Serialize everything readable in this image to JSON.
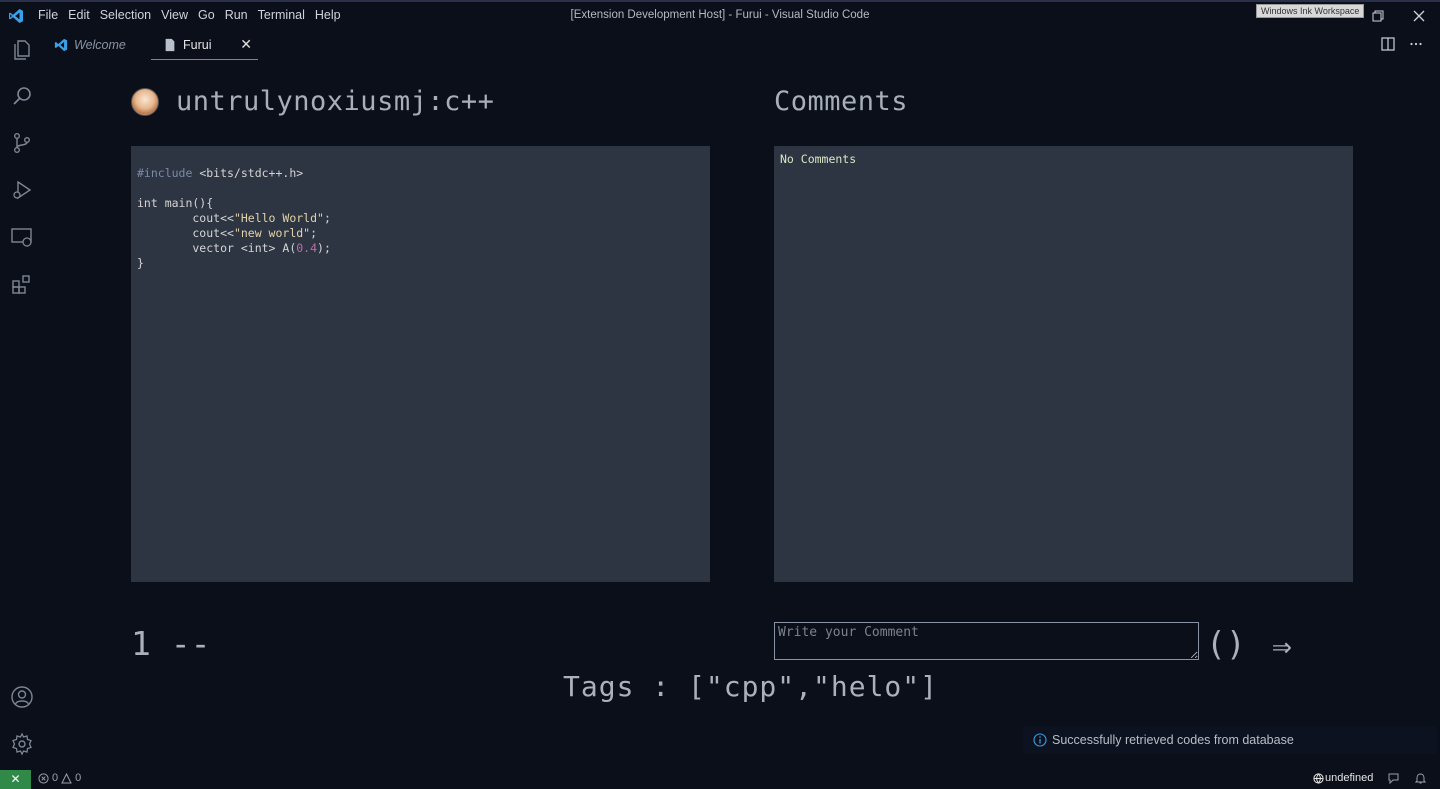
{
  "window": {
    "title": "[Extension Development Host] - Furui - Visual Studio Code",
    "ink_workspace": "Windows Ink Workspace"
  },
  "menu": [
    "File",
    "Edit",
    "Selection",
    "View",
    "Go",
    "Run",
    "Terminal",
    "Help"
  ],
  "tabs": {
    "welcome": "Welcome",
    "furui": "Furui"
  },
  "post": {
    "title": "untrulynoxiusmj:c++",
    "code_lines": {
      "l1_directive": "#include",
      "l1_header": " <bits/stdc++.h>",
      "l2": "int main(){",
      "l3_a": "        cout<<",
      "l3_str": "\"Hello World\"",
      "l3_b": ";",
      "l4_a": "        cout<<",
      "l4_str": "\"new world\"",
      "l4_b": ";",
      "l5_a": "        vector <int> A(",
      "l5_num": "0.4",
      "l5_b": ");",
      "l6": "}"
    },
    "page_number": "1 --",
    "tags_label": "Tags : [\"cpp\",\"helo\"]"
  },
  "comments": {
    "title": "Comments",
    "empty_text": "No Comments",
    "input_placeholder": "Write your Comment",
    "paren_button": "()",
    "send_button": "⇒"
  },
  "notification": {
    "text": "Successfully retrieved codes from database"
  },
  "statusbar": {
    "errors": "0",
    "warnings": "0",
    "language": "undefined"
  },
  "colors": {
    "background": "#0b0f1a",
    "panel": "#2e3542",
    "remote": "#2f8a4a",
    "active_tab_underline": "#58a06b"
  }
}
